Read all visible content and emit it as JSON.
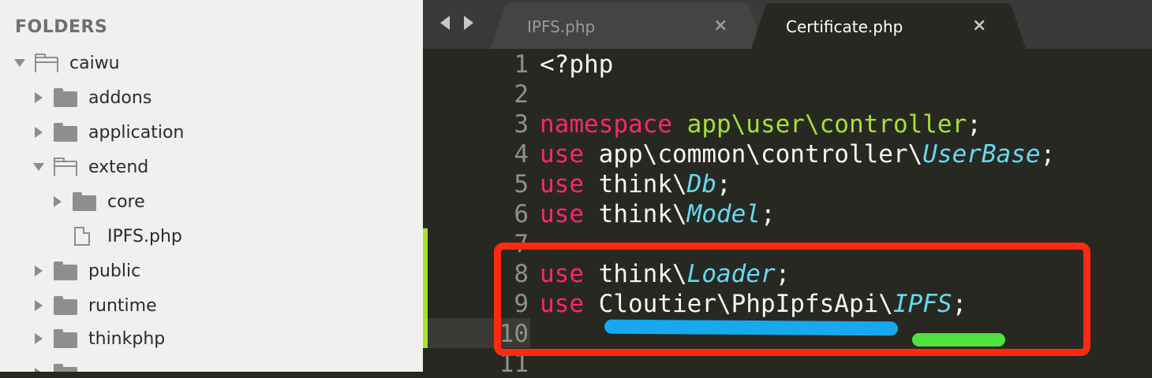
{
  "sidebar": {
    "header": "FOLDERS",
    "items": [
      {
        "label": "caiwu",
        "type": "folder-open"
      },
      {
        "label": "addons",
        "type": "folder"
      },
      {
        "label": "application",
        "type": "folder"
      },
      {
        "label": "extend",
        "type": "folder-open"
      },
      {
        "label": "core",
        "type": "folder"
      },
      {
        "label": "IPFS.php",
        "type": "file"
      },
      {
        "label": "public",
        "type": "folder"
      },
      {
        "label": "runtime",
        "type": "folder"
      },
      {
        "label": "thinkphp",
        "type": "folder"
      }
    ]
  },
  "tabs": [
    {
      "label": "IPFS.php",
      "close": "×",
      "active": false
    },
    {
      "label": "Certificate.php",
      "close": "×",
      "active": true
    }
  ],
  "editor": {
    "line_numbers": [
      "1",
      "2",
      "3",
      "4",
      "5",
      "6",
      "7",
      "8",
      "9",
      "10",
      "11"
    ],
    "code": {
      "l1": "<?php",
      "l3_kw": "namespace",
      "l3_ns": "app\\user\\controller",
      "l3_end": ";",
      "l4_kw": "use",
      "l4_path": "app\\common\\controller\\",
      "l4_class": "UserBase",
      "l4_end": ";",
      "l5_kw": "use",
      "l5_path": "think\\",
      "l5_class": "Db",
      "l5_end": ";",
      "l6_kw": "use",
      "l6_path": "think\\",
      "l6_class": "Model",
      "l6_end": ";",
      "l8_kw": "use",
      "l8_path": "think\\",
      "l8_class": "Loader",
      "l8_end": ";",
      "l9_kw": "use",
      "l9_path": "Cloutier\\PhpIpfsApi\\",
      "l9_class": "IPFS",
      "l9_end": ";"
    }
  },
  "colors": {
    "annotation_box": "#ff2a10",
    "annotation_blue": "#17a8ef",
    "annotation_green": "#4ee33f",
    "keyword": "#f92672",
    "namespace": "#a6e22e",
    "class": "#66d9ef"
  }
}
